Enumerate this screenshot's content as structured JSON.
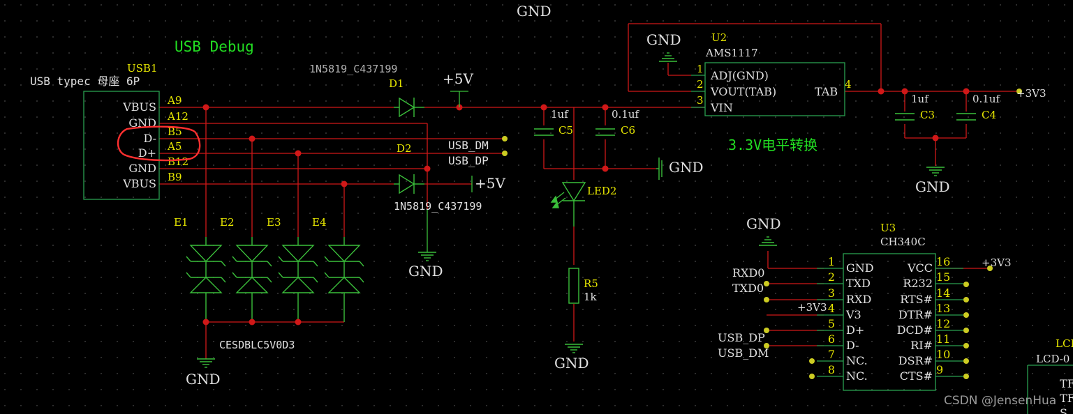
{
  "texts": {
    "gnd_top": "GND",
    "usb_debug": "USB Debug",
    "usb1_ref": "USB1",
    "usb1_name": "USB typec 母座 6P",
    "d1_part": "1N5819_C437199",
    "d1_ref": "D1",
    "p5v_top": "+5V",
    "d2_ref": "D2",
    "d2_part": "1N5819_C437199",
    "p5v_d2": "+5V",
    "usb_dm_net": "USB_DM",
    "usb_dp_net": "USB_DP",
    "gnd_usb": "GND",
    "e1": "E1",
    "e2": "E2",
    "e3": "E3",
    "e4": "E4",
    "tvs_part": "CESDBLC5V0D3",
    "gnd_tvs": "GND",
    "c5_val": "1uf",
    "c5_ref": "C5",
    "c6_val": "0.1uf",
    "c6_ref": "C6",
    "gnd_caps": "GND",
    "led2": "LED2",
    "r5_ref": "R5",
    "r5_val": "1k",
    "gnd_led": "GND",
    "u2_ref": "U2",
    "u2_part": "AMS1117",
    "gnd_u2": "GND",
    "u2_pin_adj": "ADJ(GND)",
    "u2_pin_vout": "VOUT(TAB)",
    "u2_pin_vin": "VIN",
    "u2_pin_tab": "TAB",
    "u2_n1": "1",
    "u2_n2": "2",
    "u2_n3": "3",
    "u2_n4": "4",
    "c3_val": "1uf",
    "c3_ref": "C3",
    "c4_val": "0.1uf",
    "c4_ref": "C4",
    "p3v3_reg": "+3V3",
    "gnd_reg": "GND",
    "level_shift": "3.3V电平转换",
    "gnd_u3": "GND",
    "u3_ref": "U3",
    "u3_part": "CH340C",
    "rxd0": "RXD0",
    "txd0": "TXD0",
    "p3v3_v3": "+3V3",
    "usb_dp_u3": "USB_DP",
    "usb_dm_u3": "USB_DM",
    "p3v3_vcc": "+3V3",
    "lcd_ref": "LCD",
    "lcd_part": "LCD-0",
    "lcd_tf1": "TF",
    "lcd_tf2": "TF",
    "lcd_s": "S",
    "watermark": "CSDN @JensenHua"
  },
  "usb_pins": [
    {
      "name": "VBUS",
      "num": "A9"
    },
    {
      "name": "GND",
      "num": "A12"
    },
    {
      "name": "D-",
      "num": "B5"
    },
    {
      "name": "D+",
      "num": "A5"
    },
    {
      "name": "GND",
      "num": "B12"
    },
    {
      "name": "VBUS",
      "num": "B9"
    }
  ],
  "u3_left_pins": [
    {
      "num": "1",
      "name": "GND"
    },
    {
      "num": "2",
      "name": "TXD"
    },
    {
      "num": "3",
      "name": "RXD"
    },
    {
      "num": "4",
      "name": "V3"
    },
    {
      "num": "5",
      "name": "D+"
    },
    {
      "num": "6",
      "name": "D-"
    },
    {
      "num": "7",
      "name": "NC."
    },
    {
      "num": "8",
      "name": "NC."
    }
  ],
  "u3_right_pins": [
    {
      "num": "16",
      "name": "VCC"
    },
    {
      "num": "15",
      "name": "R232"
    },
    {
      "num": "14",
      "name": "RTS#"
    },
    {
      "num": "13",
      "name": "DTR#"
    },
    {
      "num": "12",
      "name": "DCD#"
    },
    {
      "num": "11",
      "name": "RI#"
    },
    {
      "num": "10",
      "name": "DSR#"
    },
    {
      "num": "9",
      "name": "CTS#"
    }
  ],
  "colors": {
    "background": "#000000",
    "wire": "#d01818",
    "pin": "#2aa050",
    "component": "#3bbf3b",
    "label": "#e0e0e0",
    "pin_number": "#e6e600",
    "net_label": "#ffffff",
    "junction": "#d01818",
    "open_pin": "#cccc22",
    "highlight": "#ff3030",
    "title_green": "#22dd22",
    "grid_dot": "#5a5a5a"
  }
}
